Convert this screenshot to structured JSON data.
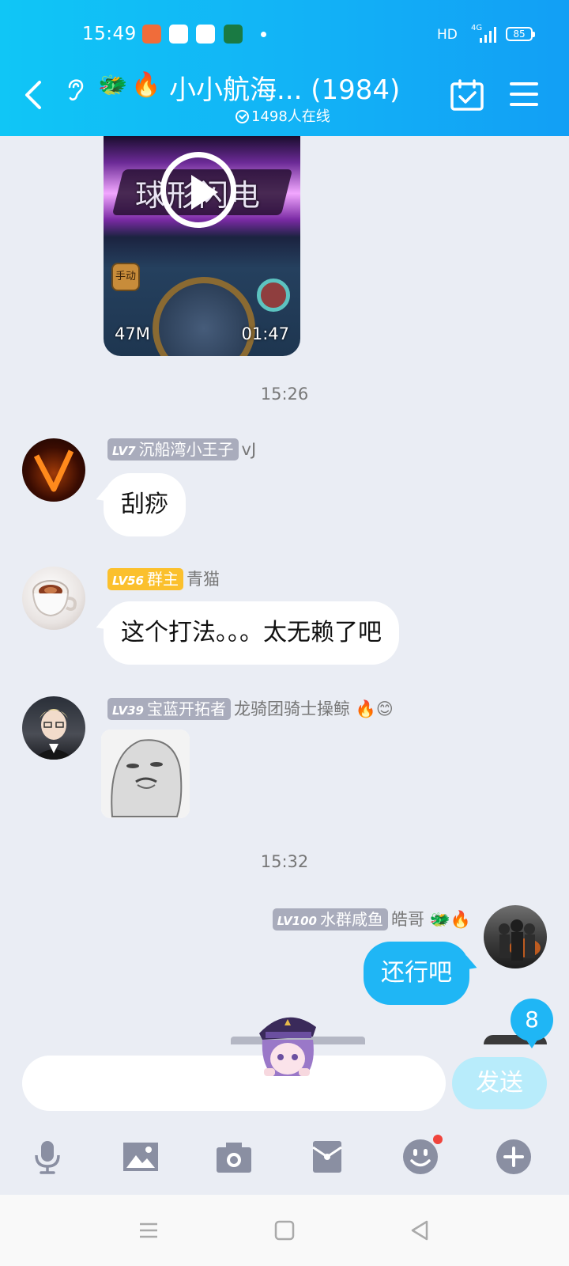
{
  "status_bar": {
    "time": "15:49",
    "network": "HD",
    "network_gen": "4G",
    "battery": "85"
  },
  "header": {
    "title": "小小航海... (1984)",
    "online_count": "1498人在线",
    "title_emojis": [
      "🐲",
      "🔥"
    ]
  },
  "video_message": {
    "size": "47M",
    "duration": "01:47",
    "banner_text": "球形闪电",
    "button_text": "手动"
  },
  "messages": [
    {
      "time": "15:26",
      "level": "LV7",
      "title": "沉船湾小王子",
      "nickname": "vJ",
      "text": "刮痧",
      "side": "left"
    },
    {
      "level": "LV56",
      "title": "群主",
      "nickname": "青猫",
      "text": "这个打法。。。太无赖了吧",
      "side": "left"
    },
    {
      "level": "LV39",
      "title": "宝蓝开拓者",
      "nickname": "龙骑团骑士操鲸",
      "emojis": [
        "🔥",
        "😊"
      ],
      "type": "sticker",
      "side": "left"
    },
    {
      "time": "15:32",
      "level": "LV100",
      "title": "水群咸鱼",
      "nickname": "皓哥",
      "emojis": [
        "🐲",
        "🔥"
      ],
      "text": "还行吧",
      "side": "right"
    }
  ],
  "new_message_count": "8",
  "input": {
    "placeholder": "",
    "send_label": "发送"
  },
  "toolbar": [
    "microphone-icon",
    "image-icon",
    "camera-icon",
    "red-packet-icon",
    "emoji-icon",
    "plus-icon"
  ],
  "colors": {
    "header": "#12b4f6",
    "accent": "#1fb6f5",
    "background": "#eaedf4",
    "owner_tag": "#fbc02d",
    "level_tag": "#a9acbc"
  }
}
